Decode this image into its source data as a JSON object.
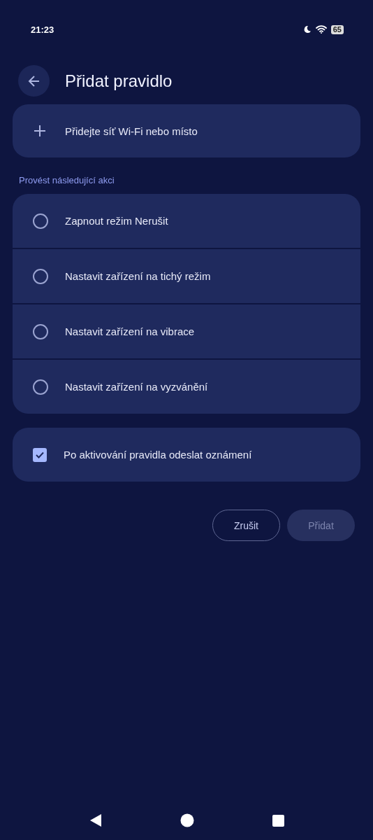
{
  "status_bar": {
    "time": "21:23",
    "battery": "65"
  },
  "header": {
    "title": "Přidat pravidlo"
  },
  "add_trigger": {
    "label": "Přidejte síť Wi-Fi nebo místo"
  },
  "section_label": "Provést následující akci",
  "actions": [
    {
      "label": "Zapnout režim Nerušit",
      "selected": false
    },
    {
      "label": "Nastavit zařízení na tichý režim",
      "selected": false
    },
    {
      "label": "Nastavit zařízení na vibrace",
      "selected": false
    },
    {
      "label": "Nastavit zařízení na vyzvánění",
      "selected": false
    }
  ],
  "notify": {
    "label": "Po aktivování pravidla odeslat oznámení",
    "checked": true
  },
  "buttons": [
    {
      "label": "Zrušit",
      "kind": "outlined",
      "disabled": false
    },
    {
      "label": "Přidat",
      "kind": "filled",
      "disabled": true
    }
  ]
}
